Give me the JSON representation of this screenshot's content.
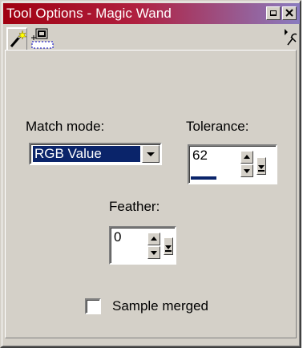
{
  "window": {
    "title": "Tool Options - Magic Wand",
    "colors": {
      "title_start": "#a00010",
      "title_end": "#8a7cc0",
      "face": "#d4d0c8",
      "selection": "#0a246a"
    }
  },
  "titlebar_buttons": [
    {
      "name": "minimize-button",
      "icon": "minimize-icon"
    },
    {
      "name": "close-button",
      "icon": "close-icon"
    }
  ],
  "tabs": [
    {
      "name": "tab-magic-wand",
      "icon": "magic-wand-icon",
      "active": true
    },
    {
      "name": "tab-selection-options",
      "icon": "selection-options-icon",
      "active": false
    }
  ],
  "toolbar_right_icon": "pin-menu-icon",
  "fields": {
    "match_mode": {
      "label": "Match mode:",
      "value": "RGB Value"
    },
    "tolerance": {
      "label": "Tolerance:",
      "value": "62",
      "max": 200
    },
    "feather": {
      "label": "Feather:",
      "value": "0",
      "max": 200
    },
    "sample_merged": {
      "label": "Sample merged",
      "checked": false
    }
  }
}
